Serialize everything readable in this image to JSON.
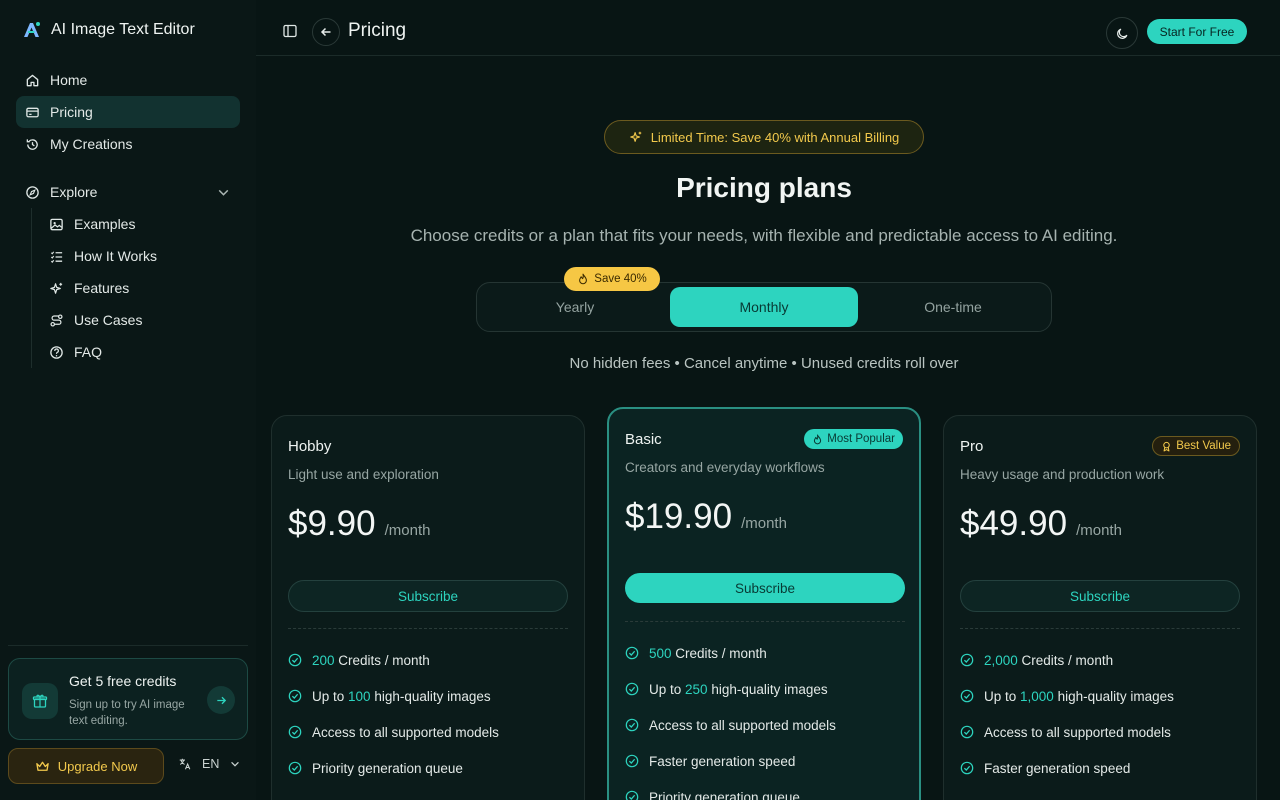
{
  "colors": {
    "accent": "#2dd4bf",
    "gold": "#f2c94c",
    "background": "#081514"
  },
  "brand": {
    "name": "AI Image Text Editor",
    "logo_icon": "ai-logo-icon"
  },
  "sidebar": {
    "nav": [
      {
        "label": "Home",
        "icon": "home-icon"
      },
      {
        "label": "Pricing",
        "icon": "card-icon"
      },
      {
        "label": "My Creations",
        "icon": "history-icon"
      }
    ],
    "explore": {
      "label": "Explore",
      "items": [
        {
          "label": "Examples",
          "icon": "image-icon"
        },
        {
          "label": "How It Works",
          "icon": "list-icon"
        },
        {
          "label": "Features",
          "icon": "sparkles-icon"
        },
        {
          "label": "Use Cases",
          "icon": "route-icon"
        },
        {
          "label": "FAQ",
          "icon": "help-icon"
        }
      ]
    },
    "promo": {
      "title": "Get 5 free credits",
      "subtitle": "Sign up to try AI image text editing."
    },
    "upgrade_label": "Upgrade Now",
    "language": "EN"
  },
  "header": {
    "title": "Pricing",
    "cta": "Start For Free"
  },
  "main": {
    "promo_pill": "Limited Time: Save 40% with Annual Billing",
    "title": "Pricing plans",
    "subtitle": "Choose credits or a plan that fits your needs, with flexible and predictable access to AI editing.",
    "billing": {
      "options": [
        "Yearly",
        "Monthly",
        "One-time"
      ],
      "selected": "Monthly",
      "save_badge": "Save 40%"
    },
    "fees_note": "No hidden fees • Cancel anytime • Unused credits roll over"
  },
  "plans": [
    {
      "name": "Hobby",
      "description": "Light use and exploration",
      "price": "$9.90",
      "period": "/month",
      "button": "Subscribe",
      "features": [
        {
          "pre": "",
          "hl": "200",
          "post": " Credits / month"
        },
        {
          "pre": "Up to ",
          "hl": "100",
          "post": " high-quality images"
        },
        {
          "pre": "Access to all supported models",
          "hl": "",
          "post": ""
        },
        {
          "pre": "Priority generation queue",
          "hl": "",
          "post": ""
        }
      ]
    },
    {
      "name": "Basic",
      "description": "Creators and everyday workflows",
      "price": "$19.90",
      "period": "/month",
      "button": "Subscribe",
      "badge": "Most Popular",
      "features": [
        {
          "pre": "",
          "hl": "500",
          "post": " Credits / month"
        },
        {
          "pre": "Up to ",
          "hl": "250",
          "post": " high-quality images"
        },
        {
          "pre": "Access to all supported models",
          "hl": "",
          "post": ""
        },
        {
          "pre": "Faster generation speed",
          "hl": "",
          "post": ""
        },
        {
          "pre": "Priority generation queue",
          "hl": "",
          "post": ""
        }
      ]
    },
    {
      "name": "Pro",
      "description": "Heavy usage and production work",
      "price": "$49.90",
      "period": "/month",
      "button": "Subscribe",
      "badge": "Best Value",
      "features": [
        {
          "pre": "",
          "hl": "2,000",
          "post": " Credits / month"
        },
        {
          "pre": "Up to ",
          "hl": "1,000",
          "post": " high-quality images"
        },
        {
          "pre": "Access to all supported models",
          "hl": "",
          "post": ""
        },
        {
          "pre": "Faster generation speed",
          "hl": "",
          "post": ""
        }
      ]
    }
  ]
}
